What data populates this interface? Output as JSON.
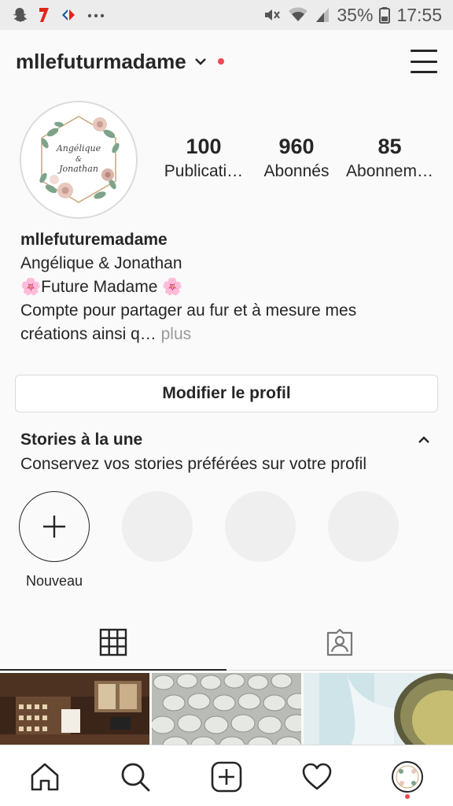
{
  "status_bar": {
    "icons_left": [
      "snapchat-icon",
      "free-mobile-icon",
      "carrefour-icon",
      "more-notifications-icon"
    ],
    "icons_right": [
      "mute-icon",
      "wifi-icon",
      "signal-icon",
      "battery-icon"
    ],
    "battery": "35%",
    "time": "17:55"
  },
  "header": {
    "username": "mllefuturmadame",
    "has_notification_dot": true
  },
  "profile": {
    "avatar_text_line1": "Angélique",
    "avatar_text_line2": "&",
    "avatar_text_line3": "Jonathan",
    "stats": [
      {
        "value": "100",
        "label": "Publicati…"
      },
      {
        "value": "960",
        "label": "Abonnés"
      },
      {
        "value": "85",
        "label": "Abonnem…"
      }
    ],
    "bio": {
      "name": "mllefuturemadame",
      "line1": "Angélique & Jonathan",
      "line2": "🌸Future Madame 🌸",
      "line3": "Compte pour partager au fur et à mesure mes",
      "line4": "créations ainsi q…",
      "more": "plus"
    },
    "edit_button": "Modifier le profil"
  },
  "highlights": {
    "title": "Stories à la une",
    "subtitle": "Conservez vos stories préférées sur votre profil",
    "new_label": "Nouveau"
  },
  "tabs": [
    "grid-icon",
    "tagged-icon"
  ],
  "bottom_nav": [
    "home-icon",
    "search-icon",
    "new-post-icon",
    "activity-heart-icon",
    "profile-avatar-icon"
  ],
  "colors": {
    "text": "#262626",
    "muted": "#999999",
    "border": "#dbdbdb",
    "notification": "#ed4956",
    "placeholder": "#efefef"
  }
}
